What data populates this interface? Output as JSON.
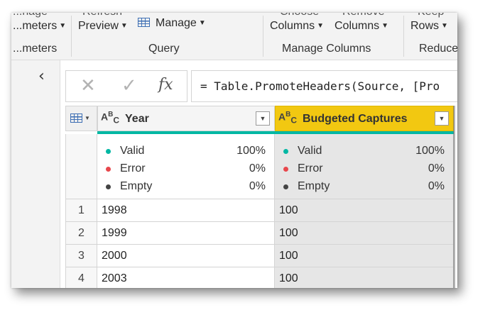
{
  "ribbon": {
    "cut_top_left": "...nage",
    "params_label": "...meters",
    "cut_refresh": "Refresh",
    "preview_label": "Preview",
    "manage_label": "Manage",
    "cut_choose": "Choose",
    "cut_remove": "Remove",
    "cut_keep": "Keep",
    "choose_columns_label": "Columns",
    "remove_columns_label": "Columns",
    "keep_rows_label": "Rows",
    "groups": {
      "parameters": "...meters",
      "query": "Query",
      "manage_columns": "Manage Columns",
      "reduce": "Reduce"
    }
  },
  "formula_bar": {
    "cancel_icon": "✕",
    "confirm_icon": "✓",
    "fx_label": "fx",
    "formula": "= Table.PromoteHeaders(Source, [Pro"
  },
  "columns": [
    {
      "type_icon": "text-type",
      "name": "Year",
      "selected": false,
      "profile": {
        "valid": "100%",
        "error": "0%",
        "empty": "0%"
      }
    },
    {
      "type_icon": "text-type",
      "name": "Budgeted Captures",
      "selected": true,
      "profile": {
        "valid": "100%",
        "error": "0%",
        "empty": "0%"
      }
    }
  ],
  "profile_labels": {
    "valid": "Valid",
    "error": "Error",
    "empty": "Empty"
  },
  "rows": [
    {
      "num": "1",
      "year": "1998",
      "budgeted": "100"
    },
    {
      "num": "2",
      "year": "1999",
      "budgeted": "100"
    },
    {
      "num": "3",
      "year": "2000",
      "budgeted": "100"
    },
    {
      "num": "4",
      "year": "2003",
      "budgeted": "100"
    }
  ],
  "colors": {
    "accent_selected_header": "#f2c811",
    "quality_bar": "#00b7a3",
    "valid_dot": "#00b7a3",
    "error_dot": "#e8474c",
    "empty_dot": "#444444"
  }
}
